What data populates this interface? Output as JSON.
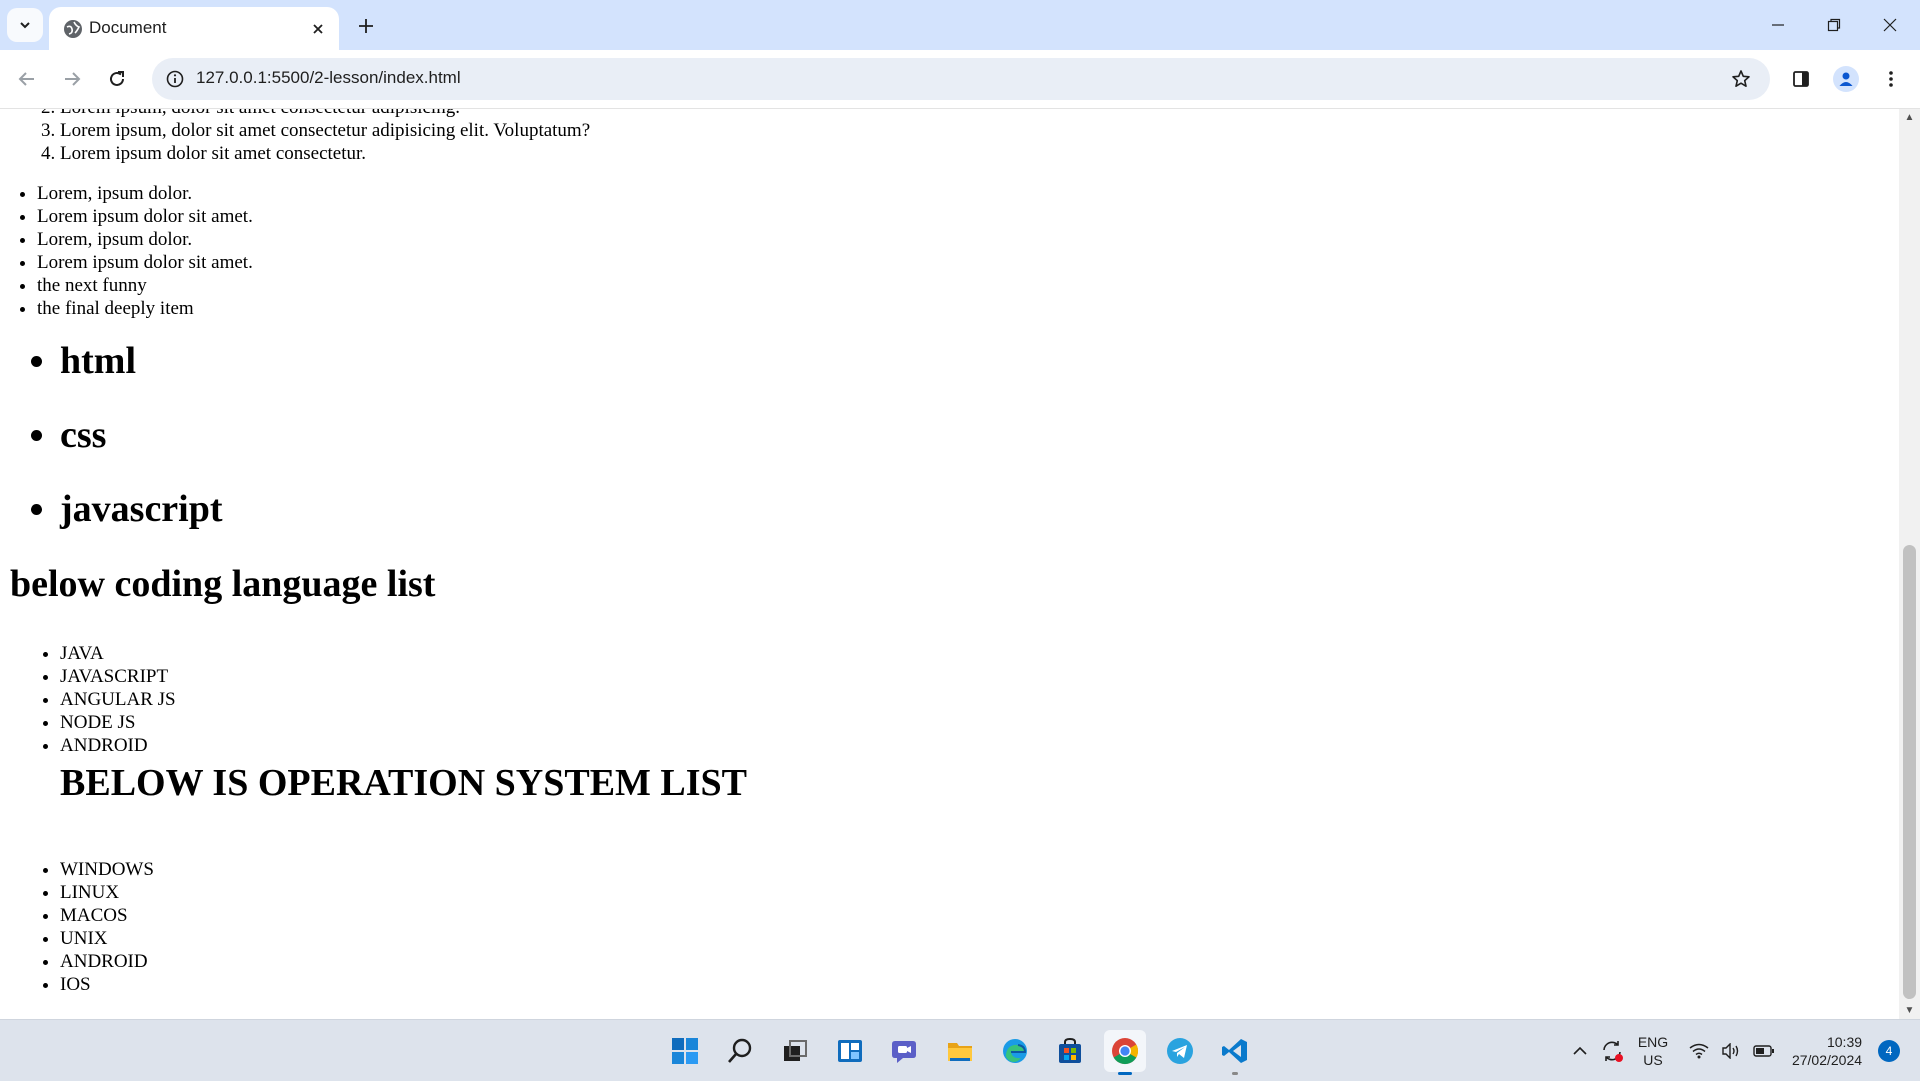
{
  "browser": {
    "tab_title": "Document",
    "url": "127.0.0.1:5500/2-lesson/index.html"
  },
  "page": {
    "ordered_list": [
      "Lorem ipsum, dolor sit amet consectetur adipisicing.",
      "Lorem ipsum, dolor sit amet consectetur adipisicing elit. Voluptatum?",
      "Lorem ipsum dolor sit amet consectetur."
    ],
    "bullet_list": [
      "Lorem, ipsum dolor.",
      "Lorem ipsum dolor sit amet.",
      "Lorem, ipsum dolor.",
      "Lorem ipsum dolor sit amet.",
      "the next funny",
      "the final deeply item"
    ],
    "big_list": [
      "html",
      "css",
      "javascript"
    ],
    "coding_heading": "below coding language list",
    "coding_list": [
      "JAVA",
      "JAVASCRIPT",
      "ANGULAR JS",
      "NODE JS",
      "ANDROID"
    ],
    "os_heading": "BELOW IS OPERATION SYSTEM LIST",
    "os_list": [
      "WINDOWS",
      "LINUX",
      "MACOS",
      "UNIX",
      "ANDROID",
      "IOS"
    ]
  },
  "taskbar": {
    "apps": [
      "start-icon",
      "search-icon",
      "task-view-icon",
      "widgets-icon",
      "teams-chat-icon",
      "file-explorer-icon",
      "edge-icon",
      "store-icon",
      "chrome-icon",
      "telegram-icon",
      "vscode-icon"
    ],
    "language_line1": "ENG",
    "language_line2": "US",
    "time": "10:39",
    "date": "27/02/2024",
    "notification_count": "4"
  }
}
